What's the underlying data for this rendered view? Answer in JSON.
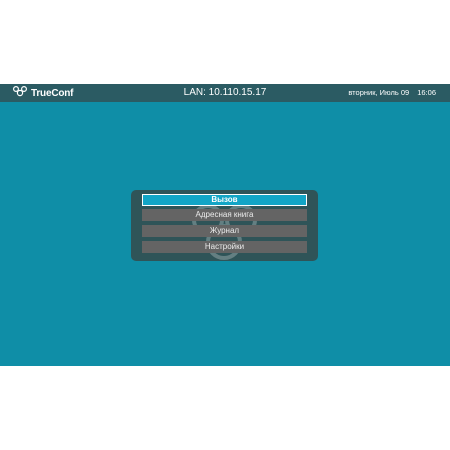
{
  "topbar": {
    "logo_text": "TrueConf",
    "lan": "LAN: 10.110.15.17",
    "date": "вторник, Июль 09",
    "time": "16:06"
  },
  "menu": {
    "items": [
      {
        "label": "Вызов",
        "selected": true
      },
      {
        "label": "Адресная книга",
        "selected": false
      },
      {
        "label": "Журнал",
        "selected": false
      },
      {
        "label": "Настройки",
        "selected": false
      }
    ]
  },
  "colors": {
    "background": "#0f8ea7",
    "topbar": "#2b5b63",
    "menu_panel": "#2f5458",
    "menu_item": "#646464",
    "menu_selected": "#12a5c6"
  }
}
